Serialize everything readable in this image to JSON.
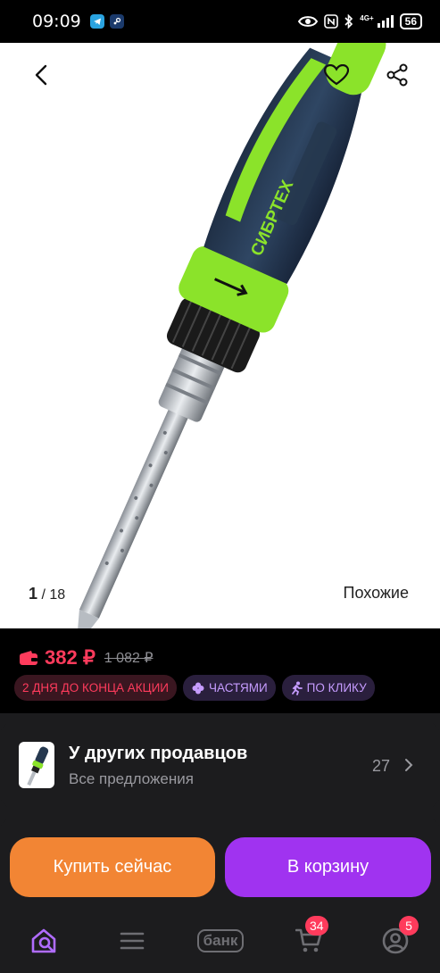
{
  "status_bar": {
    "time": "09:09",
    "battery": "56",
    "network": "4G+"
  },
  "gallery": {
    "current": "1",
    "total": "/ 18",
    "similar_label": "Похожие",
    "brand_text": "СИБРТЕХ"
  },
  "price": {
    "current": "382 ₽",
    "old": "1 082 ₽",
    "accent_color": "#ff3b5c"
  },
  "badges": {
    "promo": "2 ДНЯ ДО КОНЦА АКЦИИ",
    "installments": "ЧАСТЯМИ",
    "one_click": "ПО КЛИКУ"
  },
  "sellers": {
    "title": "У других продавцов",
    "subtitle": "Все предложения",
    "count": "27"
  },
  "actions": {
    "buy_now": "Купить сейчас",
    "add_to_cart": "В корзину",
    "buy_color": "#f28534",
    "cart_color": "#a033f0"
  },
  "nav": {
    "bank_label": "банк",
    "cart_count": "34",
    "profile_count": "5"
  }
}
